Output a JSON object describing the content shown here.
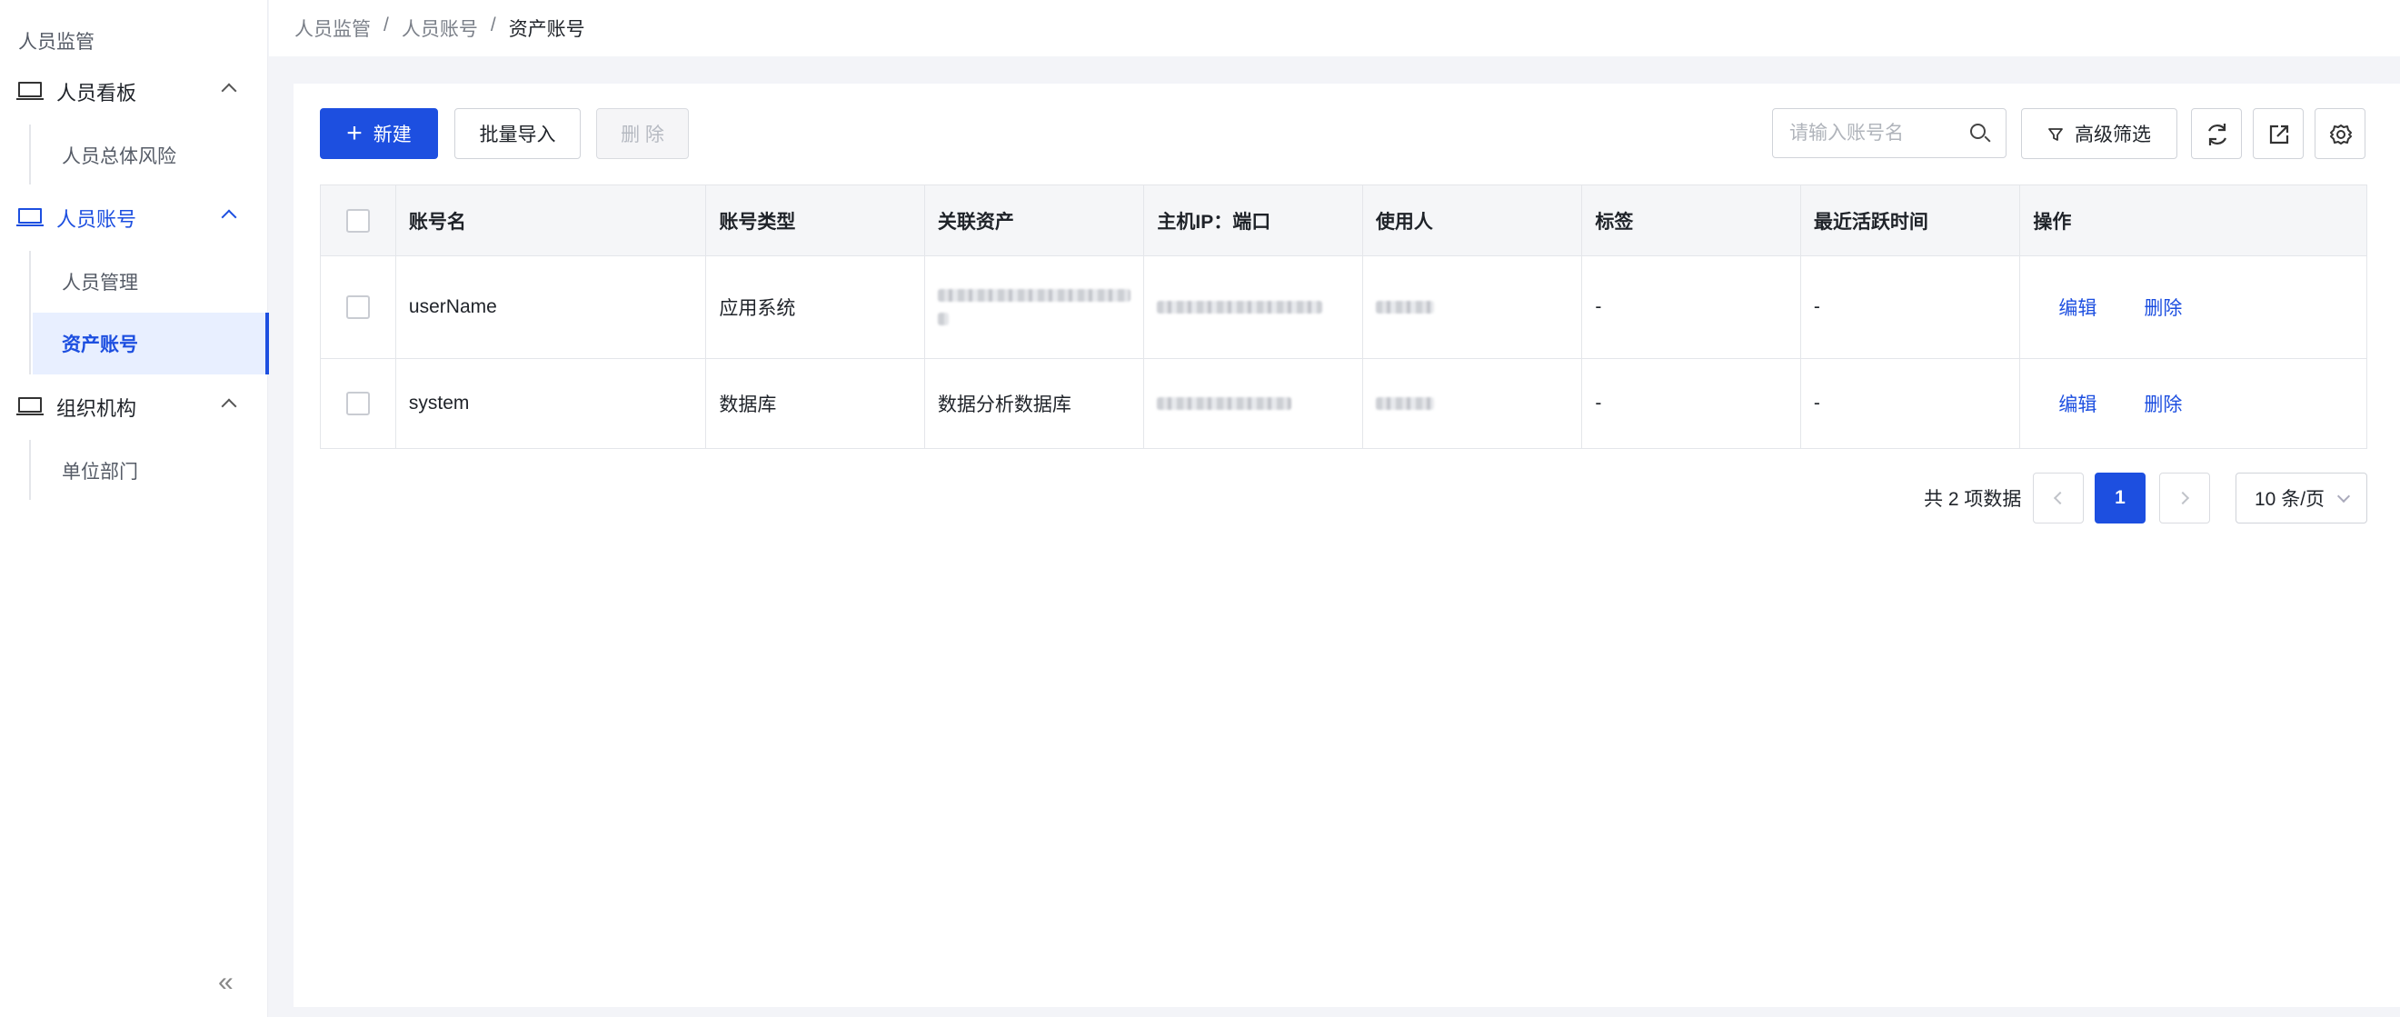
{
  "sidebar": {
    "title": "人员监管",
    "groups": [
      {
        "label": "人员看板",
        "items": [
          "人员总体风险"
        ]
      },
      {
        "label": "人员账号",
        "items": [
          "人员管理",
          "资产账号"
        ]
      },
      {
        "label": "组织机构",
        "items": [
          "单位部门"
        ]
      }
    ],
    "collapse_label": "«"
  },
  "breadcrumb": {
    "items": [
      "人员监管",
      "人员账号",
      "资产账号"
    ],
    "separator": "/"
  },
  "toolbar": {
    "new_label": "新建",
    "import_label": "批量导入",
    "delete_label": "删 除",
    "search_placeholder": "请输入账号名",
    "filter_label": "高级筛选"
  },
  "table": {
    "columns": [
      "账号名",
      "账号类型",
      "关联资产",
      "主机IP：端口",
      "使用人",
      "标签",
      "最近活跃时间",
      "操作"
    ],
    "rows": [
      {
        "account": "userName",
        "type": "应用系统",
        "asset": "",
        "host": "",
        "user": "",
        "tag": "-",
        "last_active": "-",
        "edit": "编辑",
        "delete": "删除"
      },
      {
        "account": "system",
        "type": "数据库",
        "asset": "数据分析数据库",
        "host": "",
        "user": "",
        "tag": "-",
        "last_active": "-",
        "edit": "编辑",
        "delete": "删除"
      }
    ]
  },
  "pagination": {
    "total_text": "共 2 项数据",
    "current_page": "1",
    "page_size": "10 条/页"
  },
  "colors": {
    "primary": "#1d4fe0",
    "sidebar_active_bg": "#e8efff",
    "page_bg": "#f3f4f8"
  }
}
